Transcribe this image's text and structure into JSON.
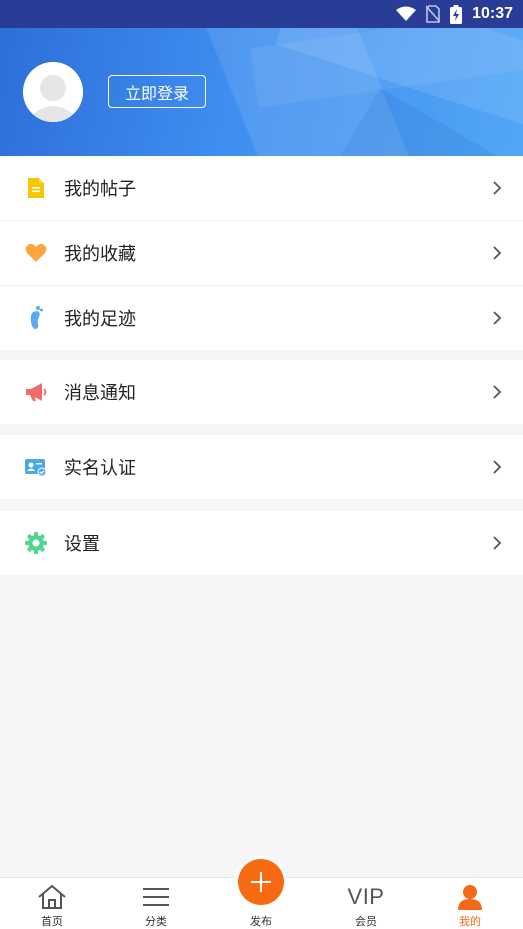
{
  "status_bar": {
    "time": "10:37"
  },
  "header": {
    "login_label": "立即登录"
  },
  "menu": {
    "items": [
      {
        "label": "我的帖子",
        "icon": "document-icon"
      },
      {
        "label": "我的收藏",
        "icon": "heart-icon"
      },
      {
        "label": "我的足迹",
        "icon": "footprint-icon"
      },
      {
        "label": "消息通知",
        "icon": "megaphone-icon"
      },
      {
        "label": "实名认证",
        "icon": "id-card-icon"
      },
      {
        "label": "设置",
        "icon": "gear-icon"
      }
    ]
  },
  "tabbar": {
    "tabs": [
      {
        "label": "首页",
        "icon": "home-icon"
      },
      {
        "label": "分类",
        "icon": "menu-icon"
      },
      {
        "label": "发布",
        "icon": "plus-icon"
      },
      {
        "label": "会员",
        "icon_text": "VIP"
      },
      {
        "label": "我的",
        "icon": "user-icon"
      }
    ],
    "active_index": 4
  },
  "colors": {
    "accent": "#f26a18",
    "header_blue": "#3f8ef0",
    "doc_yellow": "#f5c700",
    "heart_orange": "#ffa43c",
    "foot_blue": "#5aa9f3",
    "megaphone_red": "#f26a6a",
    "id_blue": "#4aa8e8",
    "gear_green": "#4fd68f"
  }
}
